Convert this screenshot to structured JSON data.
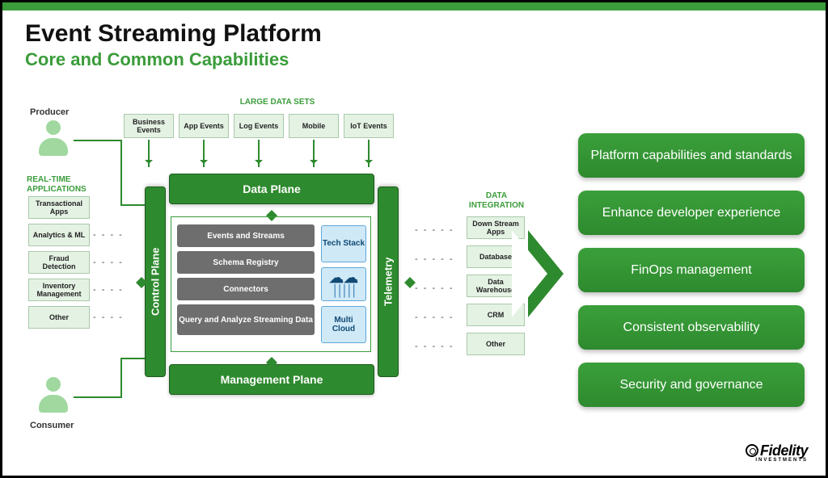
{
  "header": {
    "title": "Event Streaming Platform",
    "subtitle": "Core and Common Capabilities"
  },
  "actors": {
    "producer": "Producer",
    "consumer": "Consumer"
  },
  "large_data_sets": {
    "label": "LARGE DATA SETS",
    "items": [
      "Business Events",
      "App Events",
      "Log Events",
      "Mobile",
      "IoT Events"
    ]
  },
  "realtime": {
    "label": "REAL-TIME APPLICATIONS",
    "items": [
      "Transactional Apps",
      "Analytics & ML",
      "Fraud Detection",
      "Inventory Management",
      "Other"
    ]
  },
  "data_integration": {
    "label": "DATA INTEGRATION",
    "items": [
      "Down Stream Apps",
      "Database",
      "Data Warehouse",
      "CRM",
      "Other"
    ]
  },
  "planes": {
    "data": "Data Plane",
    "management": "Management Plane",
    "control": "Control Plane",
    "telemetry": "Telemetry"
  },
  "inner": {
    "gray": [
      "Events and Streams",
      "Schema Registry",
      "Connectors",
      "Query and Analyze Streaming Data"
    ],
    "tech_stack": "Tech Stack",
    "multi_cloud": "Multi Cloud"
  },
  "capabilities": [
    "Platform capabilities and standards",
    "Enhance developer experience",
    "FinOps management",
    "Consistent observability",
    "Security and governance"
  ],
  "brand": {
    "name": "Fidelity",
    "sub": "INVESTMENTS"
  }
}
